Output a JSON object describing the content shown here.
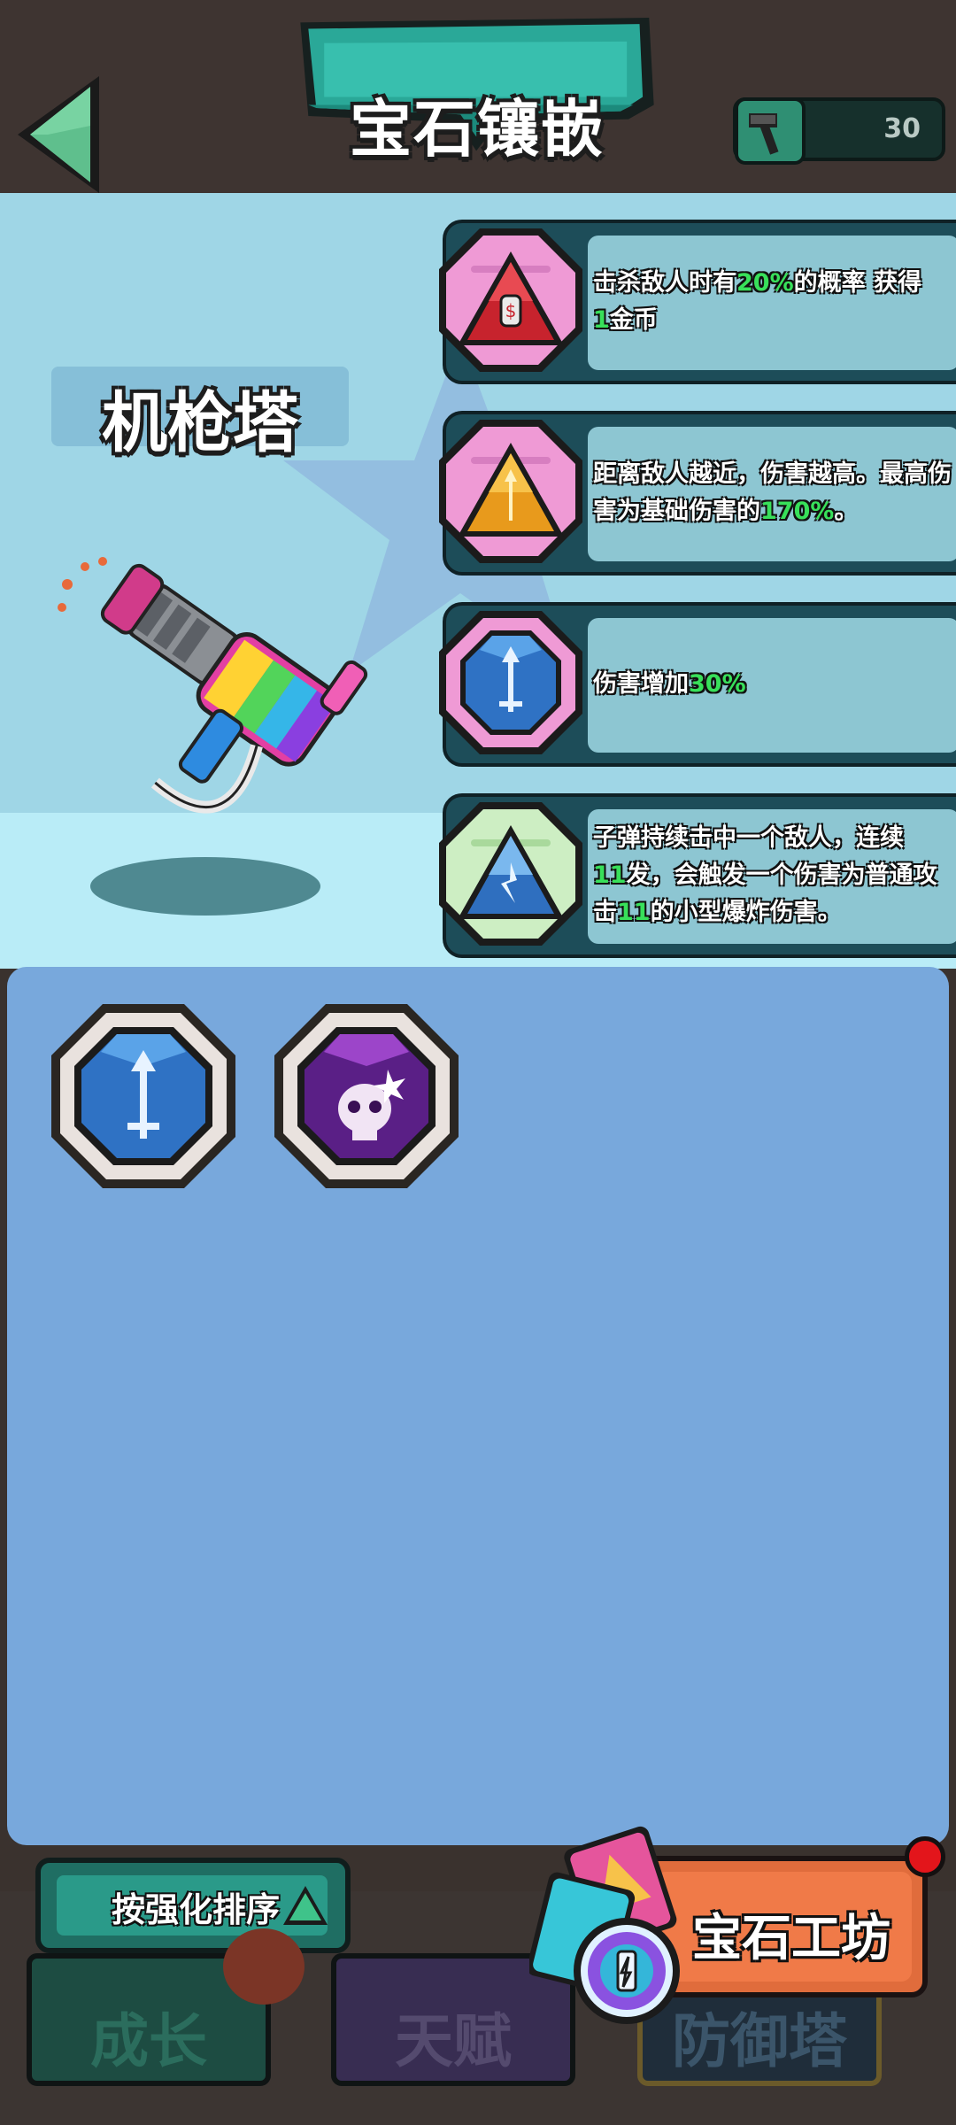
{
  "header": {
    "title": "宝石镶嵌",
    "back_icon": "back-arrow-icon",
    "hammer_icon": "hammer-icon",
    "hammer_count": "30"
  },
  "tower": {
    "name": "机枪塔",
    "image": "machine-gun-tower"
  },
  "equipped_gems": [
    {
      "icon": "gold-coin-gem-icon",
      "desc_parts": [
        "击杀敌人时有",
        "20%",
        "的概率 获得",
        "1",
        "金币"
      ]
    },
    {
      "icon": "proximity-damage-gem-icon",
      "desc_parts": [
        "距离敌人越近，伤害越高。最高伤害为基础伤害的",
        "170%",
        "。"
      ]
    },
    {
      "icon": "damage-up-gem-icon",
      "desc_parts": [
        "伤害增加",
        "30%",
        ""
      ]
    },
    {
      "icon": "explosion-gem-icon",
      "desc_parts": [
        "子弹持续击中一个敌人，连续",
        "11",
        "发，会触发一个伤害为普通攻击",
        "11",
        "的小型爆炸伤害。"
      ]
    }
  ],
  "inventory": [
    {
      "icon": "blue-sword-gem-icon"
    },
    {
      "icon": "purple-skull-gem-icon"
    }
  ],
  "sort_button": {
    "label": "按强化排序"
  },
  "workshop_button": {
    "label": "宝石工坊"
  },
  "nav": {
    "tabs": [
      {
        "label": "成长"
      },
      {
        "label": "天赋"
      },
      {
        "label": "防御塔"
      }
    ]
  },
  "colors": {
    "highlight": "#38e05a",
    "panel": "#8dc6d2",
    "inventory_bg": "#78a8dc"
  }
}
